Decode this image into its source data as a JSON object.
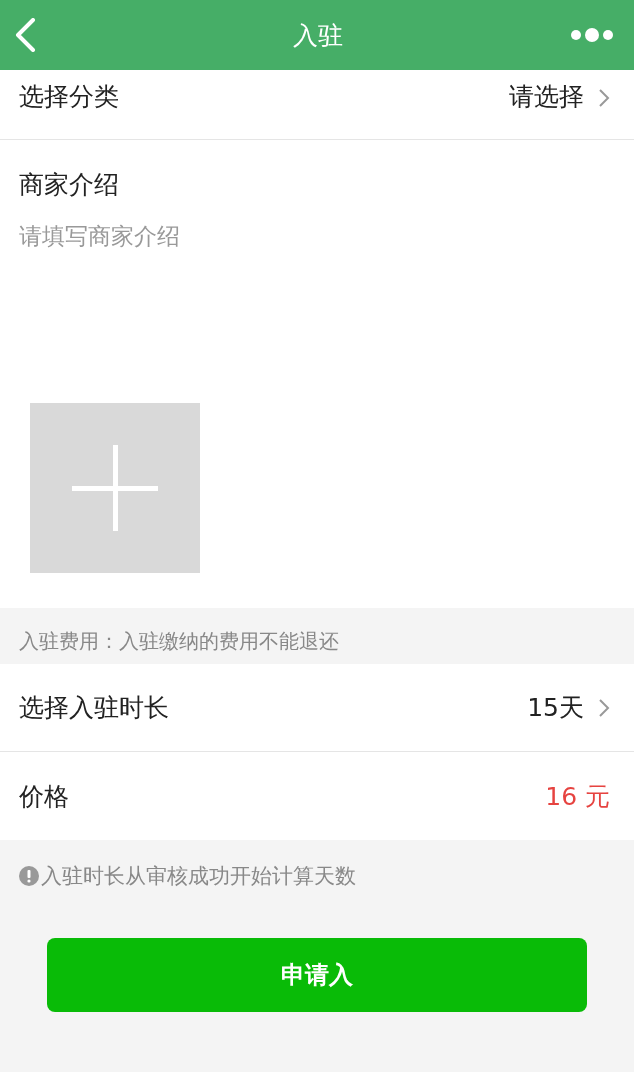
{
  "nav": {
    "title": "入驻"
  },
  "category": {
    "label": "选择分类",
    "value": "请选择"
  },
  "intro": {
    "label": "商家介绍",
    "placeholder": "请填写商家介绍"
  },
  "upload": {
    "kind": "add"
  },
  "fee_note": "入驻费用：入驻缴纳的费用不能退还",
  "duration": {
    "label": "选择入驻时长",
    "value": "15天"
  },
  "price": {
    "label": "价格",
    "value": "16 元"
  },
  "hint": "入驻时长从审核成功开始计算天数",
  "submit": {
    "label": "申请入"
  }
}
